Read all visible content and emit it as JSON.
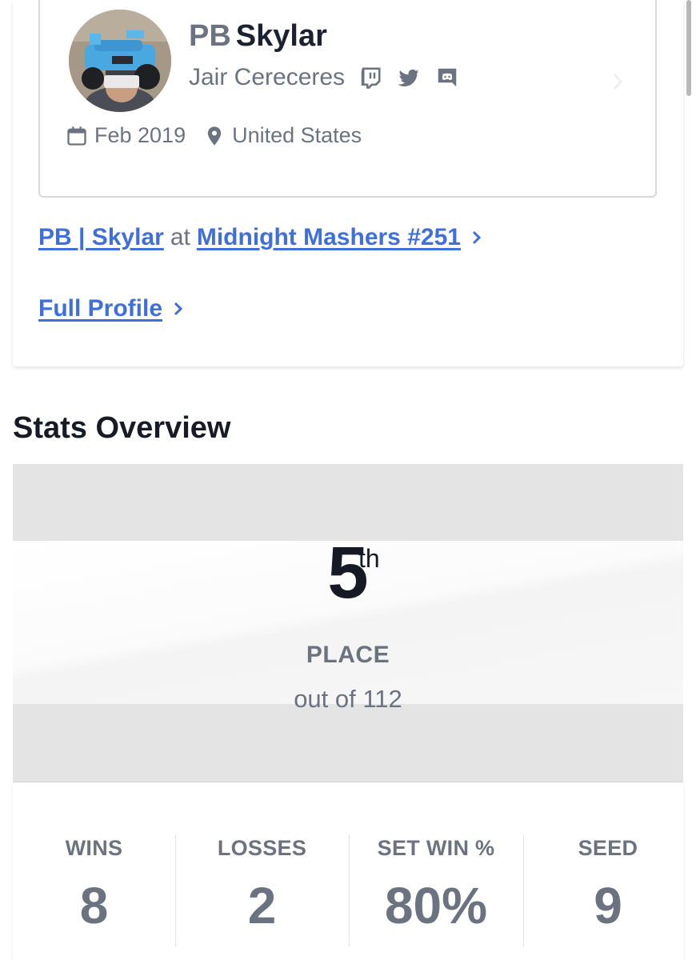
{
  "profile": {
    "prefix": "PB",
    "gamertag": "Skylar",
    "real_name": "Jair Cereceres",
    "socials": [
      "twitch-icon",
      "twitter-icon",
      "discord-icon"
    ],
    "joined": "Feb 2019",
    "location": "United States"
  },
  "links": {
    "entrant": {
      "player_label": "PB | Skylar",
      "connector": "at",
      "event_label": "Midnight Mashers #251"
    },
    "full_profile_label": "Full Profile"
  },
  "stats_overview": {
    "title": "Stats Overview",
    "placement": {
      "number": "5",
      "suffix": "th",
      "label": "PLACE",
      "out_of": "out of 112"
    },
    "items": [
      {
        "label": "WINS",
        "value": "8"
      },
      {
        "label": "LOSSES",
        "value": "2"
      },
      {
        "label": "SET WIN %",
        "value": "80%"
      },
      {
        "label": "SEED",
        "value": "9"
      }
    ]
  },
  "colors": {
    "link": "#3f6fd8",
    "muted_text": "#6b7380",
    "heading": "#161b26",
    "placement_bg": "#e4e4e4"
  }
}
